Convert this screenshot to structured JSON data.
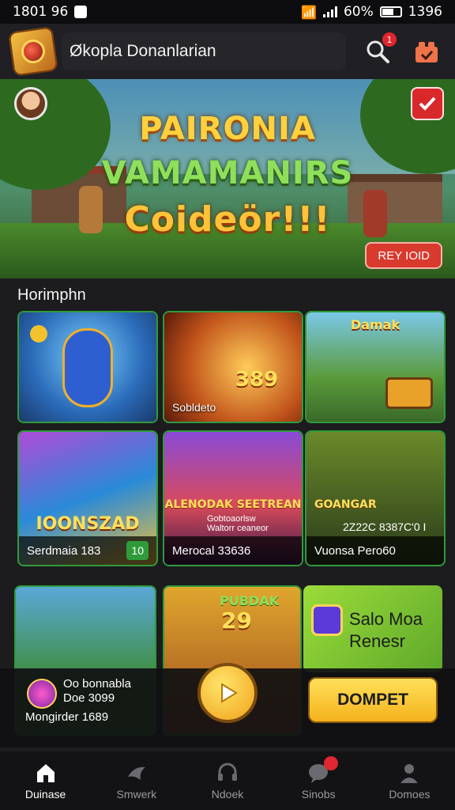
{
  "status_bar": {
    "time": "1801 96",
    "battery": "60%",
    "clock_right": "1396"
  },
  "header": {
    "search_text": "Økopla Donanlarian",
    "notifications_badge": "1"
  },
  "banner": {
    "title_line1": "PAIRONIA",
    "title_line2": "VAMAMANIRS",
    "title_line3": "Coidеör!!!",
    "button_label": "REY IOID",
    "top_button_label": ""
  },
  "section": {
    "title": "Horimphn"
  },
  "tiles": [
    {
      "caption": ""
    },
    {
      "caption": "Sobldeto",
      "number": "389"
    },
    {
      "caption": "",
      "top_label": "Damak"
    },
    {
      "title": "IOONSZAD",
      "footer": "Serdmaia 183",
      "chip": "10"
    },
    {
      "title": "ALENODAK SEETREAN",
      "subtitle": "Gobtoaorlsw\nWaltorr ceaneor",
      "footer": "Merocal 33636",
      "chip": ""
    },
    {
      "title": "GOANGAR",
      "subtitle": "2Z22C 8387C'0 I",
      "footer": "Vuonsa Pero60",
      "chip": ""
    }
  ],
  "promo": {
    "mid_title": "PUBDAK",
    "mid_number": "29",
    "right_text_line1": "Salo Moa",
    "right_text_line2": "Renesr"
  },
  "cta": {
    "name": "Oo bonnabla",
    "amount": "Doe 3099",
    "footer": "Mongirder 1689",
    "deposit_label": "DOMPET"
  },
  "tabs": [
    {
      "label": "Duinase",
      "icon": "home-icon"
    },
    {
      "label": "Smwerk",
      "icon": "bird-icon"
    },
    {
      "label": "Ndoek",
      "icon": "headset-icon"
    },
    {
      "label": "Sinobs",
      "icon": "chat-icon",
      "badge": ""
    },
    {
      "label": "Domoes",
      "icon": "profile-icon"
    }
  ],
  "colors": {
    "accent_green": "#2f9b3a",
    "deposit_yellow": "#f4b21c",
    "badge_red": "#e0262e"
  }
}
